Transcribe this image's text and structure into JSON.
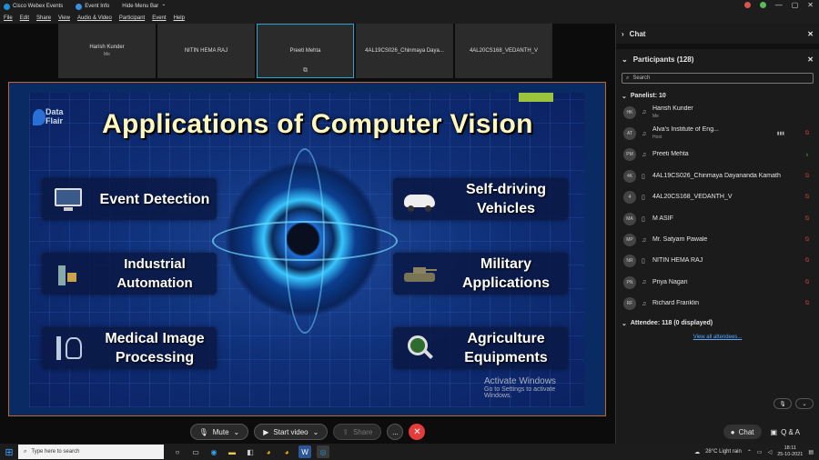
{
  "titlebar": {
    "app_title": "Cisco Webex Events",
    "event_info": "Event Info",
    "hide_menu": "Hide Menu Bar"
  },
  "menu": [
    "File",
    "Edit",
    "Share",
    "View",
    "Audio & Video",
    "Participant",
    "Event",
    "Help"
  ],
  "thumbnails": [
    {
      "name": "Harish Kunder",
      "sub": "Me"
    },
    {
      "name": "NITIN HEMA RAJ",
      "sub": ""
    },
    {
      "name": "Preeti Mehta",
      "sub": ""
    },
    {
      "name": "4AL19CS026_Chinmaya Daya...",
      "sub": ""
    },
    {
      "name": "4AL20CS168_VEDANTH_V",
      "sub": ""
    }
  ],
  "slide": {
    "title": "Applications of Computer Vision",
    "logo_line1": "Data",
    "logo_line2": "Flair",
    "cards_left": [
      "Event Detection",
      "Industrial Automation",
      "Medical Image Processing"
    ],
    "cards_right": [
      "Self-driving Vehicles",
      "Military Applications",
      "Agriculture Equipments"
    ],
    "watermark_title": "Activate Windows",
    "watermark_sub": "Go to Settings to activate Windows."
  },
  "controls": {
    "mute": "Mute",
    "start_video": "Start video",
    "share": "Share",
    "more": "...",
    "end": "✕"
  },
  "panel": {
    "chat_header": "Chat",
    "participants_header": "Participants (128)",
    "search_placeholder": "Search",
    "panelist_header": "Panelist: 10",
    "attendee_header": "Attendee: 118 (0 displayed)",
    "view_all": "View all attendees...",
    "chat_button": "Chat",
    "qa_button": "Q & A",
    "panelists": [
      {
        "initials": "HK",
        "name": "Harish Kunder",
        "sub": "Me",
        "device": "headset",
        "mic": "none"
      },
      {
        "initials": "AT",
        "name": "Alva's Institute of Eng...",
        "sub": "Host",
        "device": "headset",
        "mic": "muted"
      },
      {
        "initials": "PM",
        "name": "Preeti Mehta",
        "sub": "",
        "device": "headset",
        "mic": "on"
      },
      {
        "initials": "4K",
        "name": "4AL19CS026_Chinmaya Dayananda Kamath",
        "sub": "",
        "device": "phone",
        "mic": "muted"
      },
      {
        "initials": "4",
        "name": "4AL20CS168_VEDANTH_V",
        "sub": "",
        "device": "phone",
        "mic": "muted"
      },
      {
        "initials": "MA",
        "name": "M ASIF",
        "sub": "",
        "device": "phone",
        "mic": "muted"
      },
      {
        "initials": "MP",
        "name": "Mr. Satyam Pawale",
        "sub": "",
        "device": "headset",
        "mic": "muted"
      },
      {
        "initials": "NR",
        "name": "NITIN HEMA RAJ",
        "sub": "",
        "device": "phone",
        "mic": "muted"
      },
      {
        "initials": "PN",
        "name": "Priya Nagari",
        "sub": "",
        "device": "headset",
        "mic": "muted"
      },
      {
        "initials": "RF",
        "name": "Richard Franklin",
        "sub": "",
        "device": "headset",
        "mic": "muted"
      }
    ]
  },
  "taskbar": {
    "search_placeholder": "Type here to search",
    "weather": "28°C  Light rain",
    "time": "18:11",
    "date": "25-10-2021"
  },
  "colors": {
    "accent": "#2fa3d6",
    "end_call": "#e43b3b",
    "muted": "#e04848",
    "unmuted": "#3dbb5b"
  }
}
